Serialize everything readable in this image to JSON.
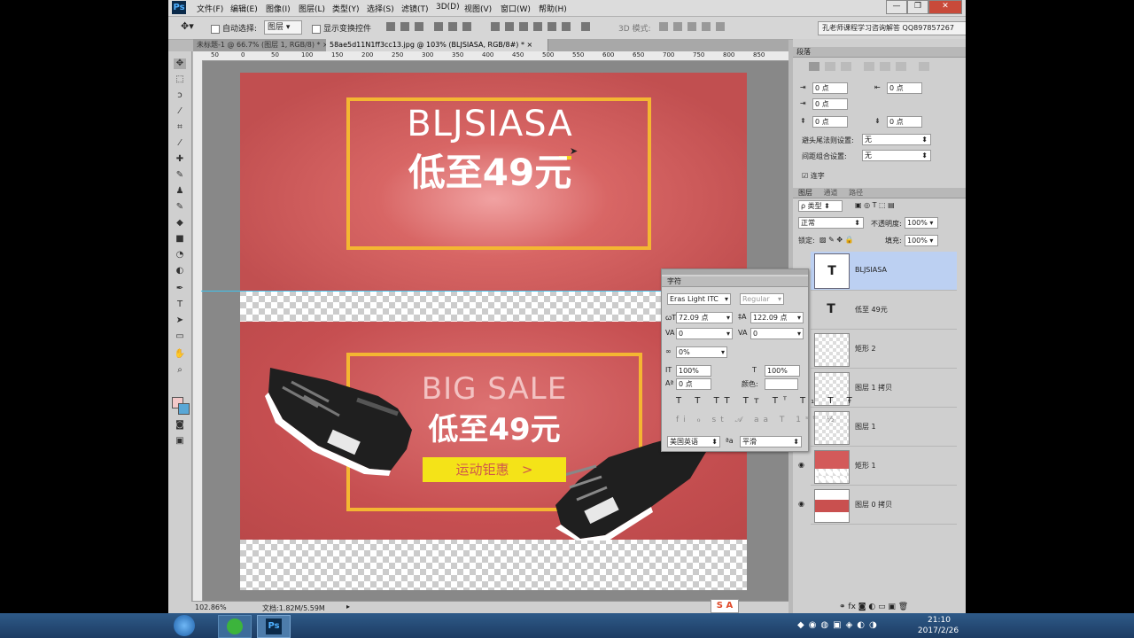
{
  "app": {
    "logo": "Ps"
  },
  "menu": [
    "文件(F)",
    "编辑(E)",
    "图像(I)",
    "图层(L)",
    "类型(Y)",
    "选择(S)",
    "滤镜(T)",
    "3D(D)",
    "视图(V)",
    "窗口(W)",
    "帮助(H)"
  ],
  "window_controls": {
    "minimize": "—",
    "restore": "❐",
    "close": "✕"
  },
  "options_bar": {
    "auto_select_label": "自动选择:",
    "auto_select_value": "图层",
    "show_transform_label": "显示变换控件",
    "mode_3d_label": "3D 模式:",
    "promo_text": "孔老师课程学习咨询解答 QQ897857267"
  },
  "tabs": [
    {
      "label": "未标题-1 @ 66.7% (图层 1, RGB/8) *",
      "close": "×"
    },
    {
      "label": "58ae5d11N1ff3cc13.jpg @ 103% (BLJSIASA, RGB/8#) *",
      "close": "×"
    }
  ],
  "ruler_ticks": [
    "50",
    "0",
    "50",
    "100",
    "150",
    "200",
    "250",
    "300",
    "350",
    "400",
    "450",
    "500",
    "550",
    "600",
    "650",
    "700",
    "750",
    "800",
    "850"
  ],
  "canvas": {
    "banner1": {
      "title_en": "BLJSIASA",
      "title_cn": "低至49元"
    },
    "banner2": {
      "title_en": "BIG SALE",
      "title_cn": "低至49元",
      "button": "运动钜惠",
      "button_icon": ">"
    }
  },
  "status": {
    "zoom": "102.86%",
    "doc": "文档:1.82M/5.59M"
  },
  "paragraph_panel": {
    "tab": "段落",
    "indent_left": "0 点",
    "indent_right": "0 点",
    "indent_first": "0 点",
    "space_before": "0 点",
    "space_after": "0 点",
    "kinsoku_label": "避头尾法则设置:",
    "kinsoku_value": "无",
    "mojikumi_label": "间距组合设置:",
    "mojikumi_value": "无",
    "hyphen_label": "连字"
  },
  "layers_panel": {
    "tabs": [
      "图层",
      "通道",
      "路径"
    ],
    "filter": "ρ 类型",
    "blend": "正常",
    "opacity_label": "不透明度:",
    "opacity": "100%",
    "lock_label": "锁定:",
    "fill_label": "填充:",
    "fill": "100%",
    "layers": [
      {
        "name": "BLJSIASA",
        "type": "T",
        "visible": false,
        "selected": true
      },
      {
        "name": "低至 49元",
        "type": "T",
        "visible": false,
        "selected": false
      },
      {
        "name": "矩形 2",
        "type": "shape",
        "visible": false,
        "selected": false
      },
      {
        "name": "图层 1 拷贝",
        "type": "pixel",
        "visible": false,
        "selected": false
      },
      {
        "name": "图层 1",
        "type": "pixel",
        "visible": false,
        "selected": false
      },
      {
        "name": "矩形 1",
        "type": "shape",
        "visible": true,
        "selected": false
      },
      {
        "name": "图层 0 拷贝",
        "type": "pixel",
        "visible": true,
        "selected": false
      }
    ]
  },
  "char_panel": {
    "title": "字符",
    "font_family": "Eras Light ITC",
    "font_style": "Regular",
    "font_size": "72.09 点",
    "leading": "122.09 点",
    "kerning": "0",
    "tracking": "0",
    "tsume": "0%",
    "vscale": "100%",
    "hscale": "100%",
    "baseline": "0 点",
    "color_label": "颜色:",
    "language": "美国英语",
    "aa_label": "ªa",
    "antialias": "平滑"
  },
  "taskbar": {
    "time": "21:10",
    "date": "2017/2/26"
  }
}
